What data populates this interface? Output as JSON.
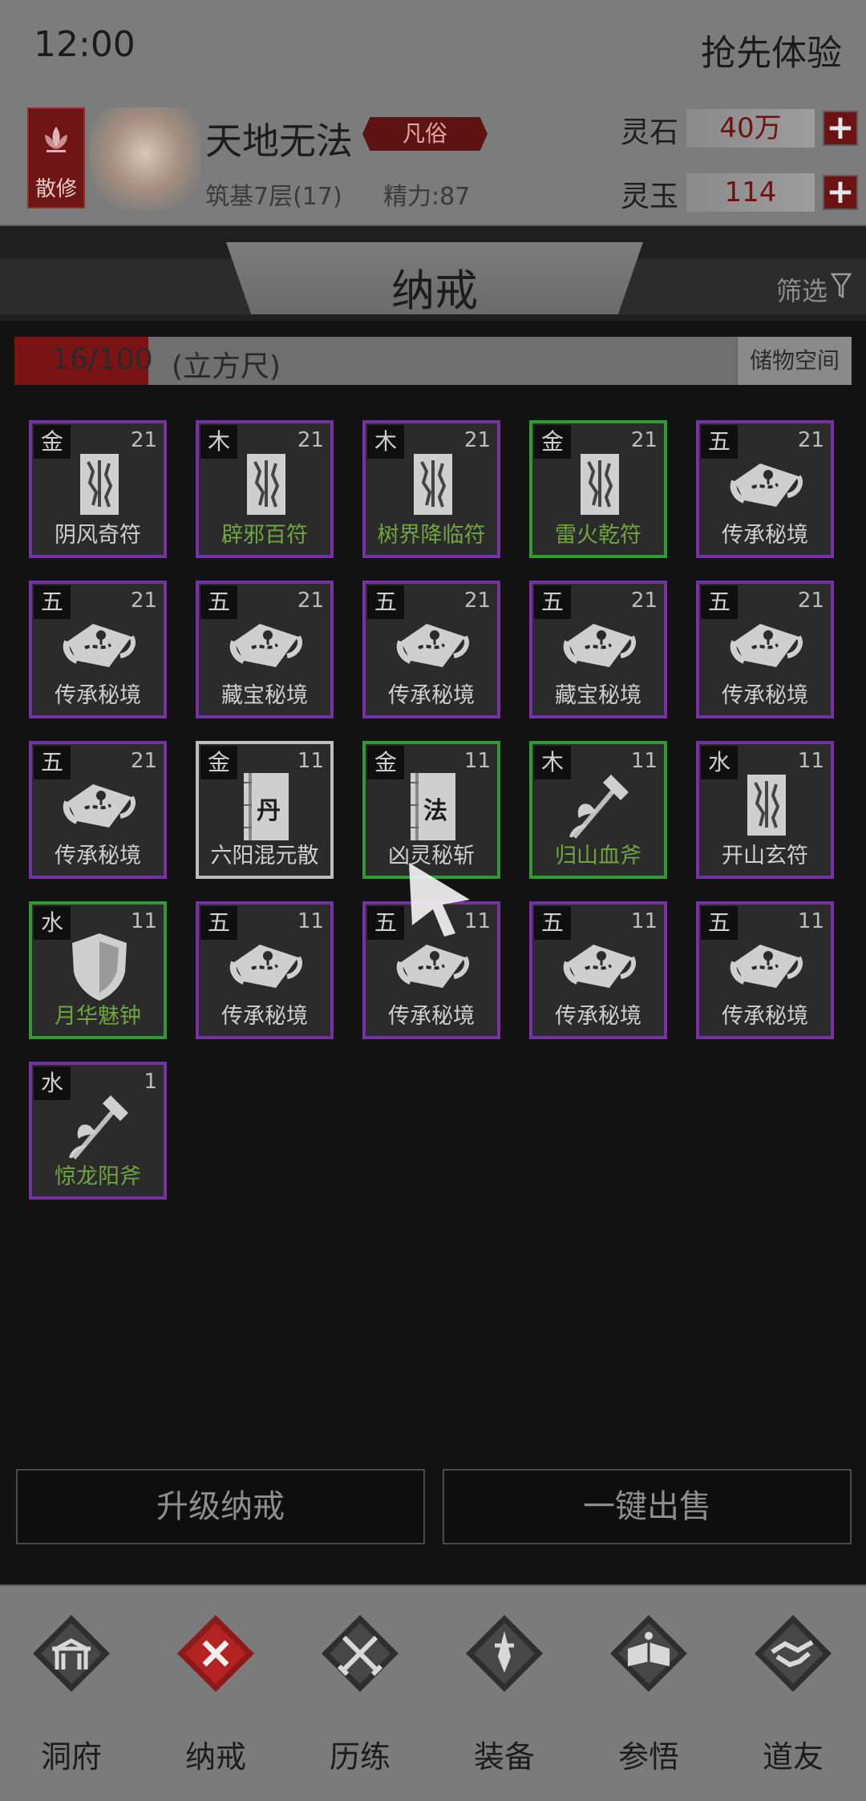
{
  "status": {
    "time": "12:00",
    "early_access": "抢先体验"
  },
  "player": {
    "sect": "散修",
    "name": "天地无法",
    "rank": "凡俗",
    "realm": "筑基7层(17)",
    "energy": "精力:87"
  },
  "currency": {
    "spirit_stone": {
      "label": "灵石",
      "value": "40万"
    },
    "spirit_jade": {
      "label": "灵玉",
      "value": "114"
    }
  },
  "bag": {
    "title": "纳戒",
    "filter": "筛选",
    "capacity": "16/100",
    "capacity_fraction": 0.16,
    "capacity_unit": "(立方尺)",
    "storage_button": "储物空间"
  },
  "items": [
    {
      "element": "金",
      "count": "21",
      "name": "阴风奇符",
      "icon": "talisman-icon",
      "border": "purple",
      "name_color": "white"
    },
    {
      "element": "木",
      "count": "21",
      "name": "辟邪百符",
      "icon": "talisman-icon",
      "border": "purple",
      "name_color": "green"
    },
    {
      "element": "木",
      "count": "21",
      "name": "树界降临符",
      "icon": "talisman-icon",
      "border": "purple",
      "name_color": "green"
    },
    {
      "element": "金",
      "count": "21",
      "name": "雷火乾符",
      "icon": "talisman-icon",
      "border": "green",
      "name_color": "green"
    },
    {
      "element": "五",
      "count": "21",
      "name": "传承秘境",
      "icon": "map-scroll-icon",
      "border": "purple",
      "name_color": "white"
    },
    {
      "element": "五",
      "count": "21",
      "name": "传承秘境",
      "icon": "map-scroll-icon",
      "border": "purple",
      "name_color": "white"
    },
    {
      "element": "五",
      "count": "21",
      "name": "藏宝秘境",
      "icon": "map-scroll-icon",
      "border": "purple",
      "name_color": "white"
    },
    {
      "element": "五",
      "count": "21",
      "name": "传承秘境",
      "icon": "map-scroll-icon",
      "border": "purple",
      "name_color": "white"
    },
    {
      "element": "五",
      "count": "21",
      "name": "藏宝秘境",
      "icon": "map-scroll-icon",
      "border": "purple",
      "name_color": "white"
    },
    {
      "element": "五",
      "count": "21",
      "name": "传承秘境",
      "icon": "map-scroll-icon",
      "border": "purple",
      "name_color": "white"
    },
    {
      "element": "五",
      "count": "21",
      "name": "传承秘境",
      "icon": "map-scroll-icon",
      "border": "purple",
      "name_color": "white"
    },
    {
      "element": "金",
      "count": "11",
      "name": "六阳混元散",
      "icon": "pill-book-icon",
      "glyph": "丹",
      "border": "white",
      "name_color": "white"
    },
    {
      "element": "金",
      "count": "11",
      "name": "凶灵秘斩",
      "icon": "technique-book-icon",
      "glyph": "法",
      "border": "green",
      "name_color": "white"
    },
    {
      "element": "木",
      "count": "11",
      "name": "归山血斧",
      "icon": "axe-icon",
      "border": "green",
      "name_color": "green"
    },
    {
      "element": "水",
      "count": "11",
      "name": "开山玄符",
      "icon": "talisman-icon",
      "border": "purple",
      "name_color": "white"
    },
    {
      "element": "水",
      "count": "11",
      "name": "月华魅钟",
      "icon": "shield-icon",
      "border": "green",
      "name_color": "green"
    },
    {
      "element": "五",
      "count": "11",
      "name": "传承秘境",
      "icon": "map-scroll-icon",
      "border": "purple",
      "name_color": "white"
    },
    {
      "element": "五",
      "count": "11",
      "name": "传承秘境",
      "icon": "map-scroll-icon",
      "border": "purple",
      "name_color": "white"
    },
    {
      "element": "五",
      "count": "11",
      "name": "传承秘境",
      "icon": "map-scroll-icon",
      "border": "purple",
      "name_color": "white"
    },
    {
      "element": "五",
      "count": "11",
      "name": "传承秘境",
      "icon": "map-scroll-icon",
      "border": "purple",
      "name_color": "white"
    },
    {
      "element": "水",
      "count": "1",
      "name": "惊龙阳斧",
      "icon": "axe-icon",
      "border": "purple",
      "name_color": "green"
    }
  ],
  "actions": {
    "upgrade": "升级纳戒",
    "sell_all": "一键出售"
  },
  "nav": [
    {
      "label": "洞府",
      "icon": "gate-icon",
      "active": false
    },
    {
      "label": "纳戒",
      "icon": "close-x-icon",
      "active": true
    },
    {
      "label": "历练",
      "icon": "crossed-swords-icon",
      "active": false
    },
    {
      "label": "装备",
      "icon": "dagger-icon",
      "active": false
    },
    {
      "label": "参悟",
      "icon": "open-book-icon",
      "active": false
    },
    {
      "label": "道友",
      "icon": "handshake-icon",
      "active": false
    }
  ],
  "colors": {
    "purple_border": "#7a2fa6",
    "green_border": "#2e9a31",
    "white_border": "#bdbdbd",
    "accent_red": "#6b1313",
    "green_text": "#6fa53e"
  }
}
